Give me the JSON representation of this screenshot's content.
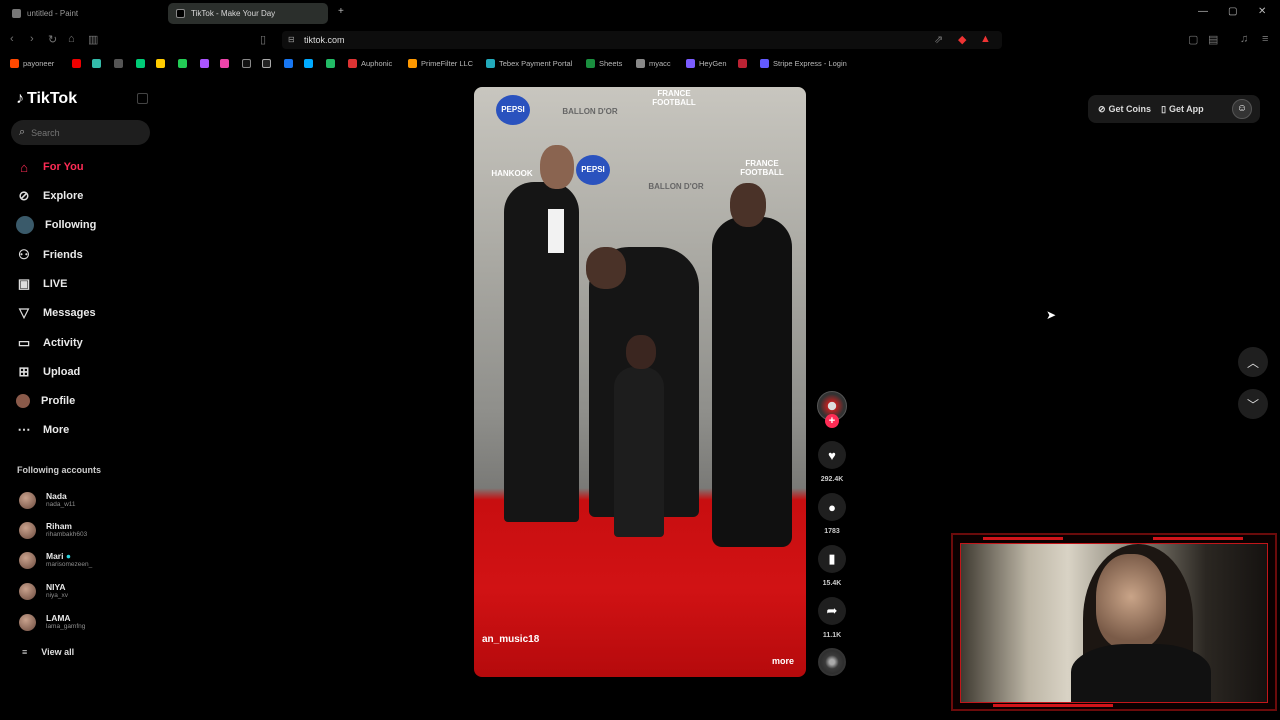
{
  "tabs": [
    {
      "label": "untitled - Paint",
      "active": false
    },
    {
      "label": "TikTok - Make Your Day",
      "active": true
    }
  ],
  "address": {
    "url": "tiktok.com"
  },
  "bookmarks": [
    {
      "label": "payoneer",
      "color": "#ff4800"
    },
    {
      "label": "Auphonic",
      "color": "#d33"
    },
    {
      "label": "PrimeFilter LLC",
      "color": "#f90"
    },
    {
      "label": "Tebex Payment Portal",
      "color": "#2ab"
    },
    {
      "label": "Sheets",
      "color": "#1a8f3f"
    },
    {
      "label": "myacc",
      "color": "#888"
    },
    {
      "label": "HeyGen",
      "color": "#7a5cff"
    },
    {
      "label": "Stripe Express - Login",
      "color": "#635bff"
    }
  ],
  "sidebar": {
    "logo": "TikTok",
    "search_placeholder": "Search",
    "nav": [
      {
        "label": "For You",
        "icon": "home-icon",
        "active": true
      },
      {
        "label": "Explore",
        "icon": "compass-icon",
        "active": false
      },
      {
        "label": "Following",
        "icon": "following-avatar-icon",
        "active": false
      },
      {
        "label": "Friends",
        "icon": "friends-icon",
        "active": false
      },
      {
        "label": "LIVE",
        "icon": "live-icon",
        "active": false
      },
      {
        "label": "Messages",
        "icon": "messages-icon",
        "active": false
      },
      {
        "label": "Activity",
        "icon": "activity-icon",
        "active": false
      },
      {
        "label": "Upload",
        "icon": "upload-icon",
        "active": false
      },
      {
        "label": "Profile",
        "icon": "profile-icon",
        "active": false
      },
      {
        "label": "More",
        "icon": "more-icon",
        "active": false
      }
    ],
    "following_title": "Following accounts",
    "accounts": [
      {
        "name": "Nada",
        "handle": "nada_w11"
      },
      {
        "name": "Riham",
        "handle": "rihambakh603"
      },
      {
        "name": "Mari",
        "handle": "marisomezeen_"
      },
      {
        "name": "NIYA",
        "handle": "niya_xv"
      },
      {
        "name": "LAMA",
        "handle": "lama_gamfng"
      }
    ],
    "view_all": "View all"
  },
  "video": {
    "username": "an_music18",
    "more": "more",
    "backdrop_logos": [
      "PEPSI",
      "BALLON D'OR",
      "FRANCE FOOTBALL",
      "BALLON D'OR",
      "FRANCE FOOTBALL",
      "PEPSI",
      "HANKOOK"
    ]
  },
  "actions": {
    "likes": "292.4K",
    "comments": "1783",
    "saves": "15.4K",
    "shares": "11.1K"
  },
  "topbar": {
    "get_coins": "Get Coins",
    "get_app": "Get App"
  }
}
